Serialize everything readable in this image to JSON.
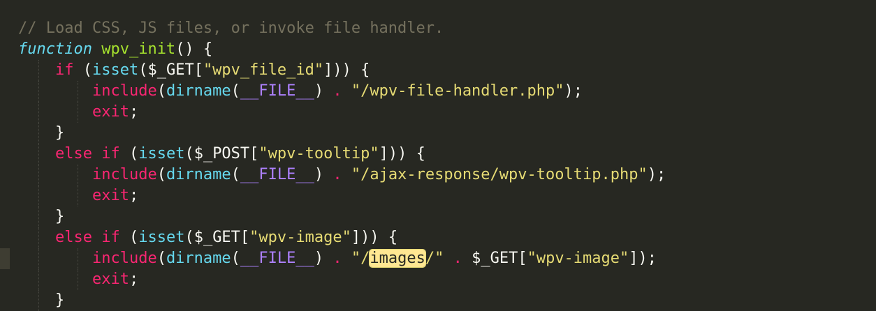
{
  "editor": {
    "colors": {
      "background": "#272822",
      "comment": "#75715e",
      "keyword": "#f92672",
      "function_name": "#a6e22e",
      "builtin": "#66d9ef",
      "constant": "#ae81ff",
      "string": "#e6db74",
      "plain": "#f8f8f2",
      "find_highlight": "#ffe792"
    },
    "lines": {
      "l1": {
        "comment": "// Load CSS, JS files, or invoke file handler."
      },
      "l2": {
        "kw": "function",
        "name": "wpv_init",
        "rest": "() {"
      },
      "l3": {
        "kw": "if",
        "p1": " (",
        "fn": "isset",
        "p2": "($_GET[",
        "str": "\"wpv_file_id\"",
        "p3": "])) {"
      },
      "l4": {
        "fn1": "include",
        "p1": "(",
        "fn2": "dirname",
        "p2": "(",
        "const": "__FILE__",
        "p3": ") ",
        "op": ".",
        "p4": " ",
        "str": "\"/wpv-file-handler.php\"",
        "p5": ");"
      },
      "l5": {
        "kw": "exit",
        "p": ";"
      },
      "l6": {
        "brace": "}"
      },
      "l7": {
        "kw1": "else",
        "sp": " ",
        "kw2": "if",
        "p1": " (",
        "fn": "isset",
        "p2": "($_POST[",
        "str": "\"wpv-tooltip\"",
        "p3": "])) {"
      },
      "l8": {
        "fn1": "include",
        "p1": "(",
        "fn2": "dirname",
        "p2": "(",
        "const": "__FILE__",
        "p3": ") ",
        "op": ".",
        "p4": " ",
        "str": "\"/ajax-response/wpv-tooltip.php\"",
        "p5": ");"
      },
      "l9": {
        "kw": "exit",
        "p": ";"
      },
      "l10": {
        "brace": "}"
      },
      "l11": {
        "kw1": "else",
        "sp": " ",
        "kw2": "if",
        "p1": " (",
        "fn": "isset",
        "p2": "($_GET[",
        "str": "\"wpv-image\"",
        "p3": "])) {"
      },
      "l12": {
        "fn1": "include",
        "p1": "(",
        "fn2": "dirname",
        "p2": "(",
        "const": "__FILE__",
        "p3": ") ",
        "op1": ".",
        "p4": " ",
        "str_a": "\"/",
        "highlight": "images",
        "str_b": "/\"",
        "p5": " ",
        "op2": ".",
        "p6": " $_GET[",
        "str2": "\"wpv-image\"",
        "p7": "]);"
      },
      "l13": {
        "kw": "exit",
        "p": ";"
      },
      "l14": {
        "brace": "}"
      }
    }
  }
}
